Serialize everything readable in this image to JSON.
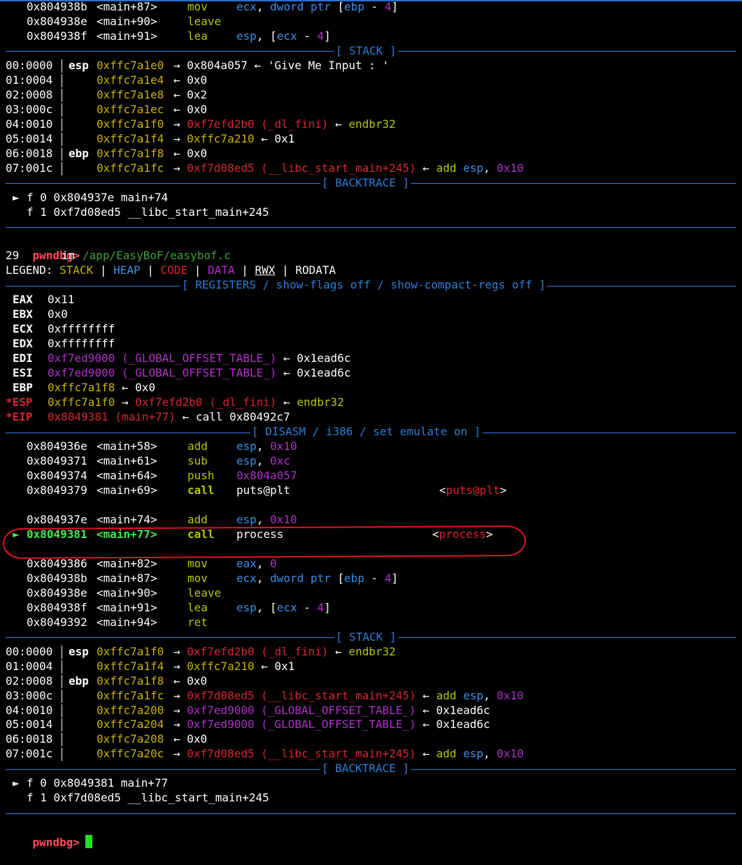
{
  "disasm_top": [
    {
      "addr": "0x804938b",
      "sym": "<main+87>",
      "mnemonic": "mov",
      "operands": "ecx, dword ptr [ebp - 4]"
    },
    {
      "addr": "0x804938e",
      "sym": "<main+90>",
      "mnemonic": "leave",
      "operands": ""
    },
    {
      "addr": "0x804938f",
      "sym": "<main+91>",
      "mnemonic": "lea",
      "operands": "esp, [ecx - 4]"
    }
  ],
  "headers": {
    "stack": "[ STACK ]",
    "backtrace": "[ BACKTRACE ]",
    "registers": "[ REGISTERS / show-flags off / show-compact-regs off ]",
    "disasm": "[ DISASM / i386 / set emulate on ]"
  },
  "stack1": [
    {
      "idx": "00:0000",
      "reg": "esp",
      "addr": "0xffc7a1e0",
      "chain": "→ 0x804a057 ← 'Give Me Input : '"
    },
    {
      "idx": "01:0004",
      "reg": "",
      "addr": "0xffc7a1e4",
      "chain": "← 0x0"
    },
    {
      "idx": "02:0008",
      "reg": "",
      "addr": "0xffc7a1e8",
      "chain": "← 0x2"
    },
    {
      "idx": "03:000c",
      "reg": "",
      "addr": "0xffc7a1ec",
      "chain": "← 0x0"
    },
    {
      "idx": "04:0010",
      "reg": "",
      "addr": "0xffc7a1f0",
      "chain": "→ 0xf7efd2b0 (_dl_fini) ← endbr32"
    },
    {
      "idx": "05:0014",
      "reg": "",
      "addr": "0xffc7a1f4",
      "chain": "→ 0xffc7a210 ← 0x1"
    },
    {
      "idx": "06:0018",
      "reg": "ebp",
      "addr": "0xffc7a1f8",
      "chain": "← 0x0"
    },
    {
      "idx": "07:001c",
      "reg": "",
      "addr": "0xffc7a1fc",
      "chain": "→ 0xf7d08ed5 (__libc_start_main+245) ← add esp, 0x10"
    }
  ],
  "backtrace1": [
    {
      "marker": "►",
      "text": "f 0 0x804937e main+74"
    },
    {
      "marker": "",
      "text": "f 1 0xf7d08ed5 __libc_start_main+245"
    }
  ],
  "prompt": "pwndbg>",
  "source_line": {
    "num": "29",
    "in": "in",
    "path": "/app/EasyBoF/easybof.c"
  },
  "legend": {
    "label": "LEGEND:",
    "stack": "STACK",
    "heap": "HEAP",
    "code": "CODE",
    "data": "DATA",
    "rwx": "RWX",
    "rodata": "RODATA",
    "sep": "|"
  },
  "registers": [
    {
      "name": "EAX",
      "val": "0x11"
    },
    {
      "name": "EBX",
      "val": "0x0"
    },
    {
      "name": "ECX",
      "val": "0xffffffff"
    },
    {
      "name": "EDX",
      "val": "0xffffffff"
    },
    {
      "name": "EDI",
      "val": "0xf7ed9000 (_GLOBAL_OFFSET_TABLE_) ← 0x1ead6c"
    },
    {
      "name": "ESI",
      "val": "0xf7ed9000 (_GLOBAL_OFFSET_TABLE_) ← 0x1ead6c"
    },
    {
      "name": "EBP",
      "val": "0xffc7a1f8 ← 0x0"
    },
    {
      "name": "*ESP",
      "val": "0xffc7a1f0 → 0xf7efd2b0 (_dl_fini) ← endbr32"
    },
    {
      "name": "*EIP",
      "val": "0x8049381 (main+77) ← call 0x80492c7"
    }
  ],
  "disasm": [
    {
      "addr": "0x804936e",
      "sym": "<main+58>",
      "mnemonic": "add",
      "operands": "esp, 0x10",
      "target": ""
    },
    {
      "addr": "0x8049371",
      "sym": "<main+61>",
      "mnemonic": "sub",
      "operands": "esp, 0xc",
      "target": ""
    },
    {
      "addr": "0x8049374",
      "sym": "<main+64>",
      "mnemonic": "push",
      "operands": "0x804a057",
      "target": ""
    },
    {
      "addr": "0x8049379",
      "sym": "<main+69>",
      "mnemonic": "call",
      "operands": "puts@plt",
      "target": "puts@plt"
    },
    {
      "addr": "0x804937e",
      "sym": "<main+74>",
      "mnemonic": "add",
      "operands": "esp, 0x10",
      "target": ""
    },
    {
      "addr": "0x8049381",
      "sym": "<main+77>",
      "mnemonic": "call",
      "operands": "process",
      "target": "process",
      "current": true
    },
    {
      "addr": "0x8049386",
      "sym": "<main+82>",
      "mnemonic": "mov",
      "operands": "eax, 0",
      "target": ""
    },
    {
      "addr": "0x804938b",
      "sym": "<main+87>",
      "mnemonic": "mov",
      "operands": "ecx, dword ptr [ebp - 4]",
      "target": ""
    },
    {
      "addr": "0x804938e",
      "sym": "<main+90>",
      "mnemonic": "leave",
      "operands": "",
      "target": ""
    },
    {
      "addr": "0x804938f",
      "sym": "<main+91>",
      "mnemonic": "lea",
      "operands": "esp, [ecx - 4]",
      "target": ""
    },
    {
      "addr": "0x8049392",
      "sym": "<main+94>",
      "mnemonic": "ret",
      "operands": "",
      "target": ""
    }
  ],
  "stack2": [
    {
      "idx": "00:0000",
      "reg": "esp",
      "addr": "0xffc7a1f0",
      "chain": "→ 0xf7efd2b0 (_dl_fini) ← endbr32"
    },
    {
      "idx": "01:0004",
      "reg": "",
      "addr": "0xffc7a1f4",
      "chain": "→ 0xffc7a210 ← 0x1"
    },
    {
      "idx": "02:0008",
      "reg": "ebp",
      "addr": "0xffc7a1f8",
      "chain": "← 0x0"
    },
    {
      "idx": "03:000c",
      "reg": "",
      "addr": "0xffc7a1fc",
      "chain": "→ 0xf7d08ed5 (__libc_start_main+245) ← add esp, 0x10"
    },
    {
      "idx": "04:0010",
      "reg": "",
      "addr": "0xffc7a200",
      "chain": "→ 0xf7ed9000 (_GLOBAL_OFFSET_TABLE_) ← 0x1ead6c"
    },
    {
      "idx": "05:0014",
      "reg": "",
      "addr": "0xffc7a204",
      "chain": "→ 0xf7ed9000 (_GLOBAL_OFFSET_TABLE_) ← 0x1ead6c"
    },
    {
      "idx": "06:0018",
      "reg": "",
      "addr": "0xffc7a208",
      "chain": "← 0x0"
    },
    {
      "idx": "07:001c",
      "reg": "",
      "addr": "0xffc7a20c",
      "chain": "→ 0xf7d08ed5 (__libc_start_main+245) ← add esp, 0x10"
    }
  ],
  "backtrace2": [
    {
      "marker": "►",
      "text": "f 0 0x8049381 main+77"
    },
    {
      "marker": "",
      "text": "f 1 0xf7d08ed5 __libc_start_main+245"
    }
  ],
  "colors": {
    "background": "#000000",
    "separator": "#2b7fd7",
    "stack_addr": "#c8b400",
    "code_red": "#d8262e",
    "rodata_purple": "#b030c8",
    "prompt": "#ff4d56",
    "current_line": "#47e84f",
    "annotation": "#e0141e"
  }
}
